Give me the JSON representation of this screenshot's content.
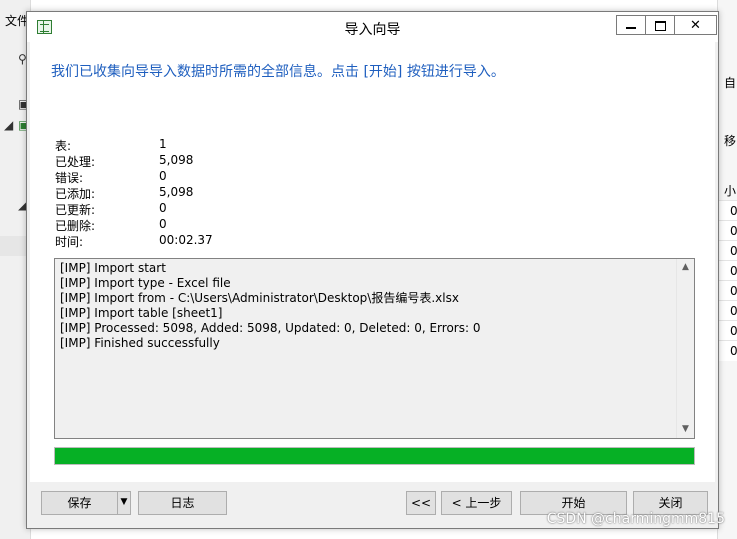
{
  "background": {
    "menu_label": "文件",
    "right_texts": [
      "自",
      "移",
      "小"
    ],
    "right_values": [
      "0",
      "0",
      "0",
      "0",
      "0",
      "0",
      "0",
      "0"
    ]
  },
  "dialog": {
    "title": "导入向导",
    "headline": "我们已收集向导导入数据时所需的全部信息。点击 [开始] 按钮进行导入。",
    "stats": [
      {
        "label": "表:",
        "value": "1"
      },
      {
        "label": "已处理:",
        "value": "5,098"
      },
      {
        "label": "错误:",
        "value": "0"
      },
      {
        "label": "已添加:",
        "value": "5,098"
      },
      {
        "label": "已更新:",
        "value": "0"
      },
      {
        "label": "已删除:",
        "value": "0"
      },
      {
        "label": "时间:",
        "value": "00:02.37"
      }
    ],
    "log": [
      "[IMP] Import start",
      "[IMP] Import type - Excel file",
      "[IMP] Import from - C:\\Users\\Administrator\\Desktop\\报告编号表.xlsx",
      "[IMP] Import table [sheet1]",
      "[IMP] Processed: 5098, Added: 5098, Updated: 0, Deleted: 0, Errors: 0",
      "[IMP] Finished successfully"
    ],
    "progress": 1.0,
    "progress_color": "#06b025",
    "buttons": {
      "save": "保存",
      "log": "日志",
      "first": "<<",
      "prev": "< 上一步",
      "start": "开始",
      "close": "关闭"
    }
  },
  "watermark": "CSDN @charmingmm815"
}
